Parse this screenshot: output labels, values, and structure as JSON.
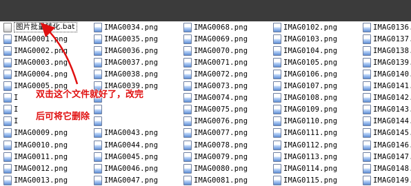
{
  "files": {
    "columns": [
      [
        "图片批量转化.bat",
        "IMAG0001.png",
        "IMAG0002.png",
        "IMAG0003.png",
        "IMAG0004.png",
        "IMAG0005.png",
        "I",
        "I",
        "I",
        "IMAG0009.png",
        "IMAG0010.png",
        "IMAG0011.png",
        "IMAG0012.png",
        "IMAG0013.png"
      ],
      [
        "IMAG0034.png",
        "IMAG0035.png",
        "IMAG0036.png",
        "IMAG0037.png",
        "IMAG0038.png",
        "IMAG0039.png",
        "",
        "",
        "",
        "IMAG0043.png",
        "IMAG0044.png",
        "IMAG0045.png",
        "IMAG0046.png",
        "IMAG0047.png"
      ],
      [
        "IMAG0068.png",
        "IMAG0069.png",
        "IMAG0070.png",
        "IMAG0071.png",
        "IMAG0072.png",
        "IMAG0073.png",
        "IMAG0074.png",
        "IMAG0075.png",
        "IMAG0076.png",
        "IMAG0077.png",
        "IMAG0078.png",
        "IMAG0079.png",
        "IMAG0080.png",
        "IMAG0081.png"
      ],
      [
        "IMAG0102.png",
        "IMAG0103.png",
        "IMAG0104.png",
        "IMAG0105.png",
        "IMAG0106.png",
        "IMAG0107.png",
        "IMAG0108.png",
        "IMAG0109.png",
        "IMAG0110.png",
        "IMAG0111.png",
        "IMAG0112.png",
        "IMAG0113.png",
        "IMAG0114.png",
        "IMAG0115.png"
      ],
      [
        "IMAG0136.png",
        "IMAG0137.png",
        "IMAG0138.png",
        "IMAG0139.png",
        "IMAG0140.png",
        "IMAG0141.png",
        "IMAG0142.png",
        "IMAG0143.png",
        "IMAG0144.png",
        "IMAG0145.png",
        "IMAG0146.png",
        "IMAG0147.png",
        "IMAG0148.png",
        "IMAG0149.png"
      ]
    ]
  },
  "annotation": {
    "line1": "双击这个文件就好了，改完",
    "line2": "后可将它删除",
    "color": "#e01010"
  },
  "colors": {
    "topbar": "#3b3b3b",
    "background": "#ffffff"
  }
}
